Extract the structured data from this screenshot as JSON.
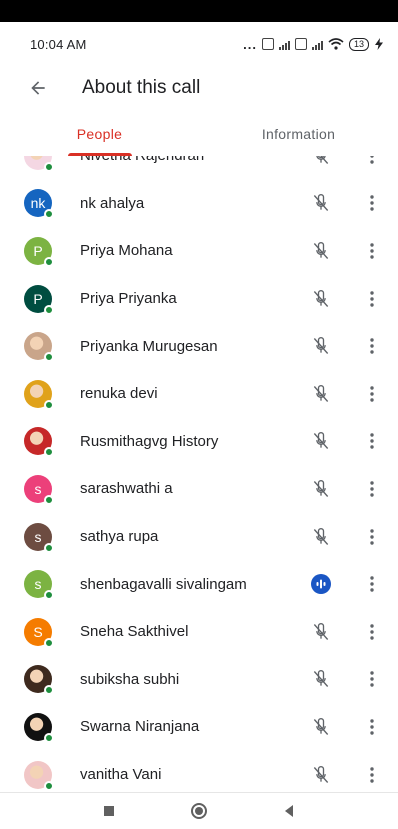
{
  "status_bar": {
    "time": "10:04 AM",
    "dots": "...",
    "battery": "13"
  },
  "app_bar": {
    "title": "About this call",
    "back_icon": "arrow-back-icon"
  },
  "tabs": [
    {
      "label": "People",
      "active": true
    },
    {
      "label": "Information",
      "active": false
    }
  ],
  "participants": [
    {
      "name": "Nivetha Rajendran",
      "initial": "",
      "avatar_color": "#f4d7e3",
      "photo": true,
      "mic": "muted"
    },
    {
      "name": "nk ahalya",
      "initial": "nk",
      "avatar_color": "#1565c0",
      "photo": false,
      "mic": "muted"
    },
    {
      "name": "Priya Mohana",
      "initial": "P",
      "avatar_color": "#7cb342",
      "photo": false,
      "mic": "muted"
    },
    {
      "name": "Priya Priyanka",
      "initial": "P",
      "avatar_color": "#004d40",
      "photo": false,
      "mic": "muted"
    },
    {
      "name": "Priyanka Murugesan",
      "initial": "",
      "avatar_color": "#c9a58a",
      "photo": true,
      "mic": "muted"
    },
    {
      "name": "renuka devi",
      "initial": "",
      "avatar_color": "#e0a21b",
      "photo": true,
      "mic": "muted"
    },
    {
      "name": "Rusmithagvg History",
      "initial": "",
      "avatar_color": "#c62828",
      "photo": true,
      "mic": "muted"
    },
    {
      "name": "sarashwathi a",
      "initial": "s",
      "avatar_color": "#ec407a",
      "photo": false,
      "mic": "muted"
    },
    {
      "name": "sathya rupa",
      "initial": "s",
      "avatar_color": "#6d4c41",
      "photo": false,
      "mic": "muted"
    },
    {
      "name": "shenbagavalli sivalingam",
      "initial": "s",
      "avatar_color": "#7cb342",
      "photo": false,
      "mic": "speaking"
    },
    {
      "name": "Sneha Sakthivel",
      "initial": "S",
      "avatar_color": "#f57c00",
      "photo": false,
      "mic": "muted"
    },
    {
      "name": "subiksha subhi",
      "initial": "",
      "avatar_color": "#3e2a1e",
      "photo": true,
      "mic": "muted"
    },
    {
      "name": "Swarna Niranjana",
      "initial": "",
      "avatar_color": "#111111",
      "photo": true,
      "mic": "muted"
    },
    {
      "name": "vanitha Vani",
      "initial": "",
      "avatar_color": "#f1c6c6",
      "photo": true,
      "mic": "muted"
    }
  ],
  "colors": {
    "accent": "#d93025",
    "online": "#1e8e3e",
    "speaking": "#1a56c4"
  },
  "nav_bar": {
    "icons": [
      "recents-square-icon",
      "home-circle-icon",
      "back-triangle-icon"
    ]
  }
}
